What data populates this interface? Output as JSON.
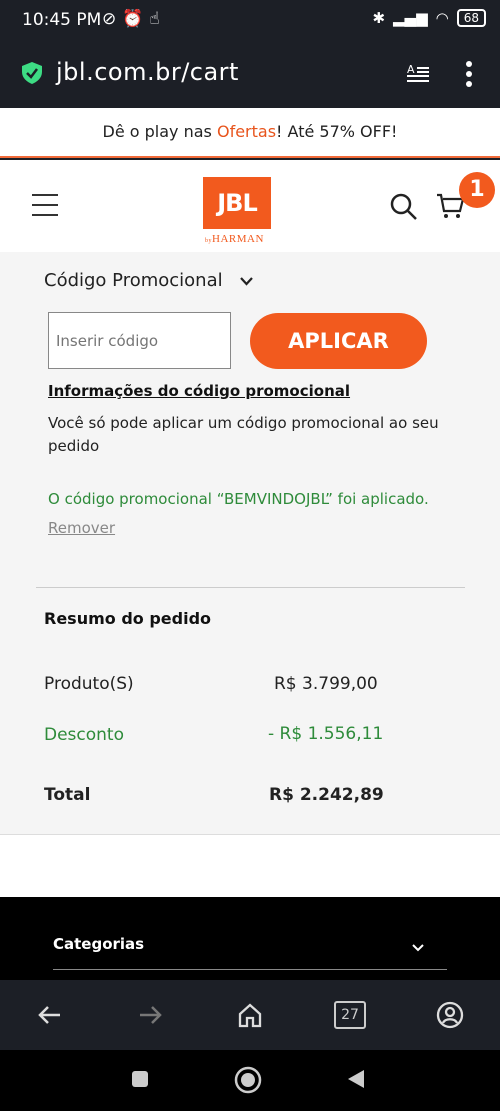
{
  "status_bar": {
    "time": "10:45 PM",
    "battery": "68"
  },
  "browser": {
    "url": "jbl.com.br/cart",
    "tab_count": "27"
  },
  "banner": {
    "prefix": "Dê o play nas ",
    "highlight": "Ofertas",
    "suffix": "! Até 57% OFF!"
  },
  "header": {
    "logo_text": "JBL",
    "logo_sub": "HARMAN",
    "logo_by": "by",
    "cart_count": "1"
  },
  "promo": {
    "heading": "Código Promocional",
    "input_placeholder": "Inserir código",
    "apply_label": "APLICAR",
    "info_link": "Informações do código promocional",
    "info_text": "Você só pode aplicar um código promocional ao seu pedido",
    "applied_message": "O código promocional “BEMVINDOJBL” foi aplicado.",
    "remove_label": "Remover"
  },
  "summary": {
    "title": "Resumo do pedido",
    "product_label": "Produto(S)",
    "product_value": "R$ 3.799,00",
    "discount_label": "Desconto",
    "discount_value": "- R$ 1.556,11",
    "total_label": "Total",
    "total_value": "R$ 2.242,89"
  },
  "footer": {
    "categories_label": "Categorias"
  },
  "colors": {
    "brand": "#f25a1e",
    "success": "#2e8b3a",
    "bar_bg": "#1c1f26"
  }
}
